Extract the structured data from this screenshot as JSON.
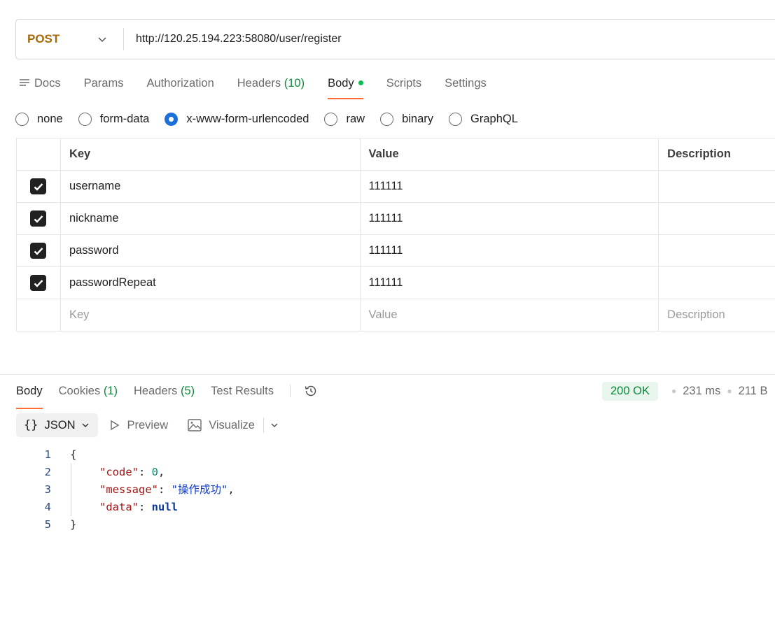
{
  "request": {
    "method": "POST",
    "url": "http://120.25.194.223:58080/user/register"
  },
  "request_tabs": [
    {
      "label": "Docs"
    },
    {
      "label": "Params"
    },
    {
      "label": "Authorization"
    },
    {
      "label": "Headers",
      "count": "(10)"
    },
    {
      "label": "Body"
    },
    {
      "label": "Scripts"
    },
    {
      "label": "Settings"
    }
  ],
  "body_types": [
    "none",
    "form-data",
    "x-www-form-urlencoded",
    "raw",
    "binary",
    "GraphQL"
  ],
  "body_type_selected": "x-www-form-urlencoded",
  "table": {
    "headers": {
      "key": "Key",
      "value": "Value",
      "description": "Description"
    },
    "rows": [
      {
        "key": "username",
        "value": "111111",
        "description": "",
        "checked": true
      },
      {
        "key": "nickname",
        "value": "111111",
        "description": "",
        "checked": true
      },
      {
        "key": "password",
        "value": "111111",
        "description": "",
        "checked": true
      },
      {
        "key": "passwordRepeat",
        "value": "111111",
        "description": "",
        "checked": true
      }
    ],
    "placeholder": {
      "key": "Key",
      "value": "Value",
      "description": "Description"
    }
  },
  "response": {
    "tabs": [
      {
        "label": "Body"
      },
      {
        "label": "Cookies",
        "count": "(1)"
      },
      {
        "label": "Headers",
        "count": "(5)"
      },
      {
        "label": "Test Results"
      }
    ],
    "status": "200 OK",
    "time": "231 ms",
    "size": "211 B",
    "format": "JSON",
    "preview_label": "Preview",
    "visualize_label": "Visualize",
    "code_lines": [
      {
        "n": "1",
        "text": "{"
      },
      {
        "n": "2",
        "key": "\"code\"",
        "val": "0"
      },
      {
        "n": "3",
        "key": "\"message\"",
        "val": "\"操作成功\""
      },
      {
        "n": "4",
        "key": "\"data\"",
        "val": "null"
      },
      {
        "n": "5",
        "text": "}"
      }
    ]
  },
  "colors": {
    "method": "#a8690c",
    "accent": "#ff6c37",
    "success": "#0b8a3a",
    "radio_selected": "#1a6fd8"
  }
}
